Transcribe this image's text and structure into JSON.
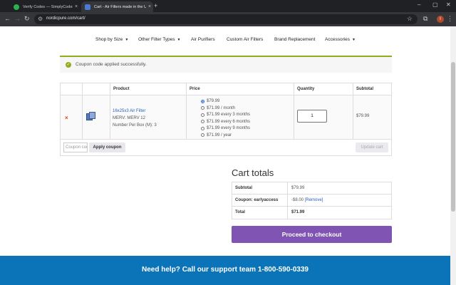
{
  "browser": {
    "tabs": [
      {
        "title": "Verify Codes — SimplyCodes",
        "active": false
      },
      {
        "title": "Cart - Air Filters made in the U",
        "active": true
      }
    ],
    "url": "nordicpure.com/cart/",
    "profile_initial": "I"
  },
  "nav": {
    "items": [
      {
        "label": "Shop by Size",
        "caret": "▼"
      },
      {
        "label": "Other Filter Types",
        "caret": "▼"
      },
      {
        "label": "Air Purifiers",
        "caret": ""
      },
      {
        "label": "Custom Air Filters",
        "caret": ""
      },
      {
        "label": "Brand Replacement",
        "caret": ""
      },
      {
        "label": "Accessories",
        "caret": "▼"
      }
    ]
  },
  "notice": {
    "text": "Coupon code applied successfully.",
    "color": "#8fae1b"
  },
  "cart": {
    "headers": {
      "product": "Product",
      "price": "Price",
      "quantity": "Quantity",
      "subtotal": "Subtotal"
    },
    "item": {
      "remove_icon": "×",
      "name": "16x25x3 Air Filter",
      "meta": [
        "MERV: MERV 12",
        "Number Per Box (M): 3"
      ],
      "price_options": [
        {
          "label": "$79.99",
          "selected": true
        },
        {
          "label": "$71.99 / month",
          "selected": false
        },
        {
          "label": "$71.99 every 3 months",
          "selected": false
        },
        {
          "label": "$71.99 every 6 months",
          "selected": false
        },
        {
          "label": "$71.99 every 9 months",
          "selected": false
        },
        {
          "label": "$71.99 / year",
          "selected": false
        }
      ],
      "quantity": "1",
      "subtotal": "$79.99"
    },
    "coupon_placeholder": "Coupon code",
    "apply_coupon_label": "Apply coupon",
    "update_cart_label": "Update cart"
  },
  "totals": {
    "title": "Cart totals",
    "rows": [
      {
        "label": "Subtotal",
        "value": "$79.99"
      },
      {
        "label": "Coupon: earlyaccess",
        "value": "-$8.00",
        "link": "[Remove]"
      },
      {
        "label": "Total",
        "value": "$71.99"
      }
    ],
    "checkout_label": "Proceed to checkout",
    "checkout_color": "#7f54b3"
  },
  "footer": {
    "text": "Need help? Call our support team 1-800-590-0339",
    "color": "#0b74b8"
  }
}
